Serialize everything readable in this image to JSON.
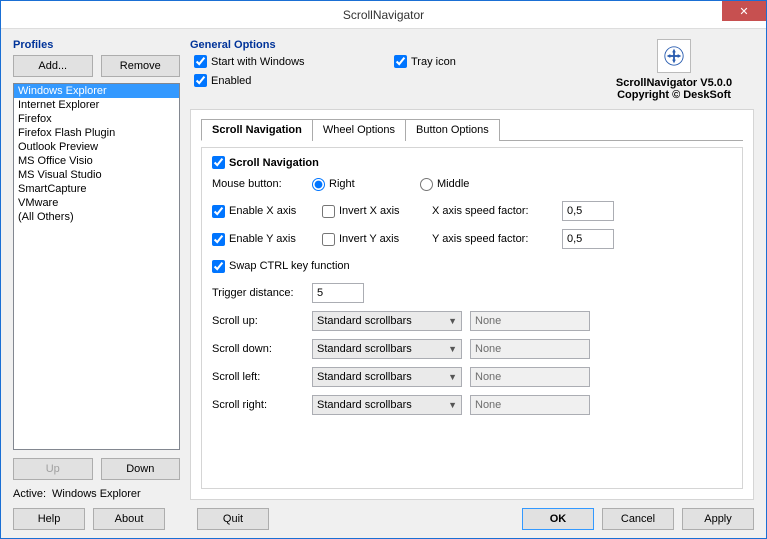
{
  "window": {
    "title": "ScrollNavigator"
  },
  "profiles": {
    "title": "Profiles",
    "add": "Add...",
    "remove": "Remove",
    "items": [
      "Windows Explorer",
      "Internet Explorer",
      "Firefox",
      "Firefox Flash Plugin",
      "Outlook Preview",
      "MS Office Visio",
      "MS Visual Studio",
      "SmartCapture",
      "VMware",
      "(All Others)"
    ],
    "selected_index": 0,
    "up": "Up",
    "down": "Down",
    "active_label": "Active:",
    "active_value": "Windows Explorer"
  },
  "general": {
    "title": "General Options",
    "start_with_windows": "Start with Windows",
    "tray_icon": "Tray icon",
    "enabled": "Enabled"
  },
  "about": {
    "line1": "ScrollNavigator V5.0.0",
    "line2": "Copyright © DeskSoft"
  },
  "tabs": {
    "t0": "Scroll Navigation",
    "t1": "Wheel Options",
    "t2": "Button Options",
    "active": 0
  },
  "scrollnav": {
    "title": "Scroll Navigation",
    "mouse_button_label": "Mouse button:",
    "right": "Right",
    "middle": "Middle",
    "enable_x": "Enable X axis",
    "invert_x": "Invert X axis",
    "x_speed_label": "X axis speed factor:",
    "x_speed": "0,5",
    "enable_y": "Enable Y axis",
    "invert_y": "Invert Y axis",
    "y_speed_label": "Y axis speed factor:",
    "y_speed": "0,5",
    "swap_ctrl": "Swap CTRL key function",
    "trigger_label": "Trigger distance:",
    "trigger": "5",
    "scroll_up_label": "Scroll up:",
    "scroll_down_label": "Scroll down:",
    "scroll_left_label": "Scroll left:",
    "scroll_right_label": "Scroll right:",
    "combo_value": "Standard scrollbars",
    "none": "None"
  },
  "buttons": {
    "help": "Help",
    "about": "About",
    "quit": "Quit",
    "ok": "OK",
    "cancel": "Cancel",
    "apply": "Apply"
  }
}
